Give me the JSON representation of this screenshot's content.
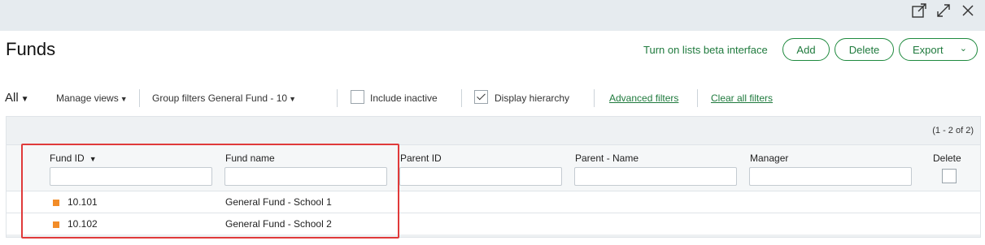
{
  "page": {
    "title": "Funds"
  },
  "actions": {
    "beta_link": "Turn on lists beta interface",
    "add": "Add",
    "delete": "Delete",
    "export": "Export"
  },
  "filters": {
    "view": "All",
    "manage_views": "Manage views",
    "group_filters_label": "Group filters",
    "group_filters_value": "General Fund - 10",
    "include_inactive": "Include inactive",
    "include_inactive_checked": false,
    "display_hierarchy": "Display hierarchy",
    "display_hierarchy_checked": true,
    "advanced_filters": "Advanced filters",
    "clear_all_filters": "Clear all filters"
  },
  "grid": {
    "count": "(1 - 2 of 2)",
    "columns": [
      "Fund ID",
      "Fund name",
      "Parent ID",
      "Parent - Name",
      "Manager",
      "Delete"
    ],
    "rows": [
      {
        "fund_id": "10.101",
        "fund_name": "General Fund - School 1"
      },
      {
        "fund_id": "10.102",
        "fund_name": "General Fund - School 2"
      }
    ]
  },
  "colors": {
    "accent": "#1f7a3d",
    "highlight": "#e03a3a",
    "row_marker": "#f28c28"
  }
}
